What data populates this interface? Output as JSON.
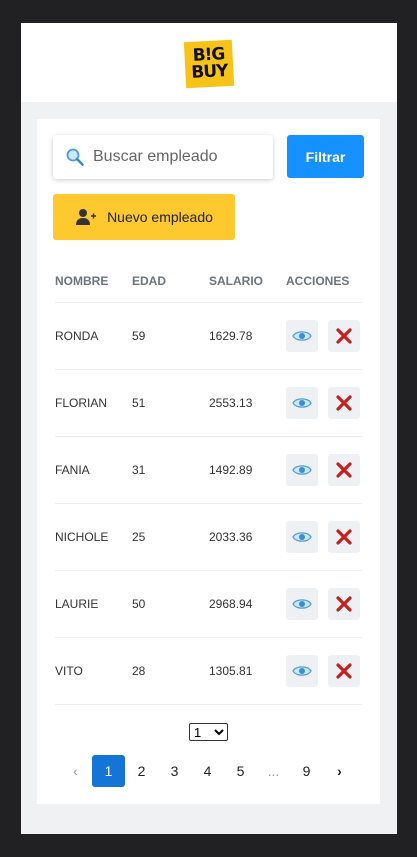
{
  "brand": {
    "logo_line1": "B!G",
    "logo_line2": "BUY",
    "logo_color": "#f7c319"
  },
  "search": {
    "placeholder": "Buscar empleado",
    "icon": "search-icon"
  },
  "filter_button": {
    "label": "Filtrar",
    "color": "#1592ff"
  },
  "new_button": {
    "label": "Nuevo empleado",
    "icon": "add-user-icon",
    "color": "#fdc92f"
  },
  "table": {
    "headers": [
      "NOMBRE",
      "EDAD",
      "SALARIO",
      "ACCIONES"
    ],
    "rows": [
      {
        "name": "RONDA",
        "age": "59",
        "salary": "1629.78"
      },
      {
        "name": "FLORIAN",
        "age": "51",
        "salary": "2553.13"
      },
      {
        "name": "FANIA",
        "age": "31",
        "salary": "1492.89"
      },
      {
        "name": "NICHOLE",
        "age": "25",
        "salary": "2033.36"
      },
      {
        "name": "LAURIE",
        "age": "50",
        "salary": "2968.94"
      },
      {
        "name": "VITO",
        "age": "28",
        "salary": "1305.81"
      }
    ],
    "view_icon": "eye-icon",
    "delete_icon": "delete-x-icon"
  },
  "page_select": {
    "value": "1"
  },
  "pagination": {
    "prev": "‹",
    "pages": [
      "1",
      "2",
      "3",
      "4",
      "5",
      "...",
      "9"
    ],
    "active": "1",
    "next": "›"
  }
}
